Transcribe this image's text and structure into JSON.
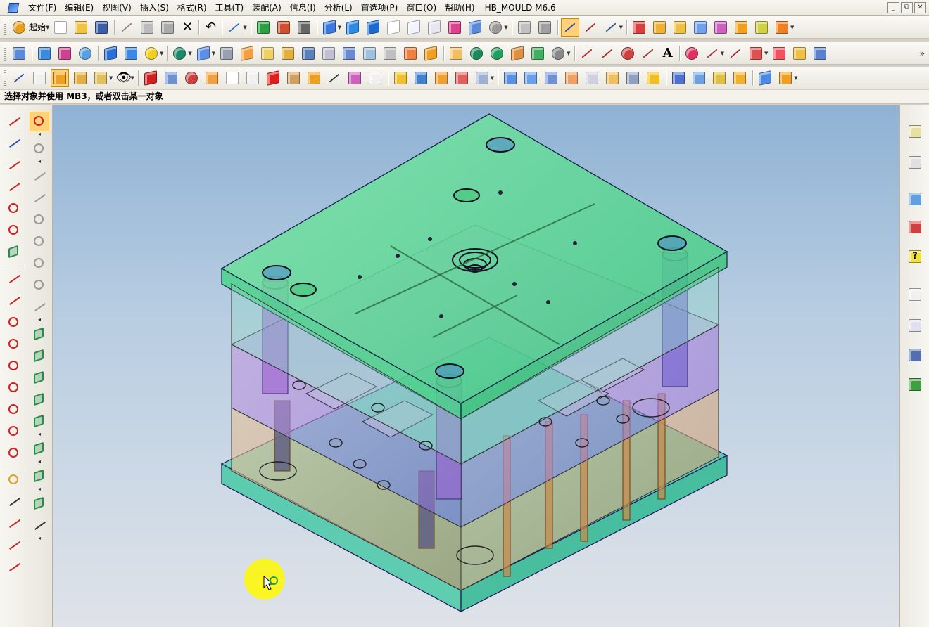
{
  "menubar": {
    "items": [
      "文件(F)",
      "编辑(E)",
      "视图(V)",
      "插入(S)",
      "格式(R)",
      "工具(T)",
      "装配(A)",
      "信息(I)",
      "分析(L)",
      "首选项(P)",
      "窗口(O)",
      "帮助(H)"
    ],
    "app_title": "HB_MOULD M6.6",
    "window_controls": [
      "_",
      "⧉",
      "✕"
    ]
  },
  "toolbar": {
    "start_label": "起始",
    "text_tool_glyph": "A",
    "overflow_glyph": "»"
  },
  "cue_line": "选择对象并使用 MB3，或者双击某一对象",
  "colors": {
    "mold_top_plate": "#2fd078",
    "mold_mid_plate": "#b37ad6",
    "mold_core_plate": "#d9a67a",
    "mold_bottom_plate": "#30c9a8",
    "highlight": "#ffd27a"
  },
  "icons": {
    "right_dock": [
      "assembly-navigator-icon",
      "part-navigator-icon",
      "history-icon",
      "roles-icon",
      "help-icon",
      "clock-icon",
      "palette-icon",
      "analysis-icon",
      "users-icon"
    ]
  }
}
